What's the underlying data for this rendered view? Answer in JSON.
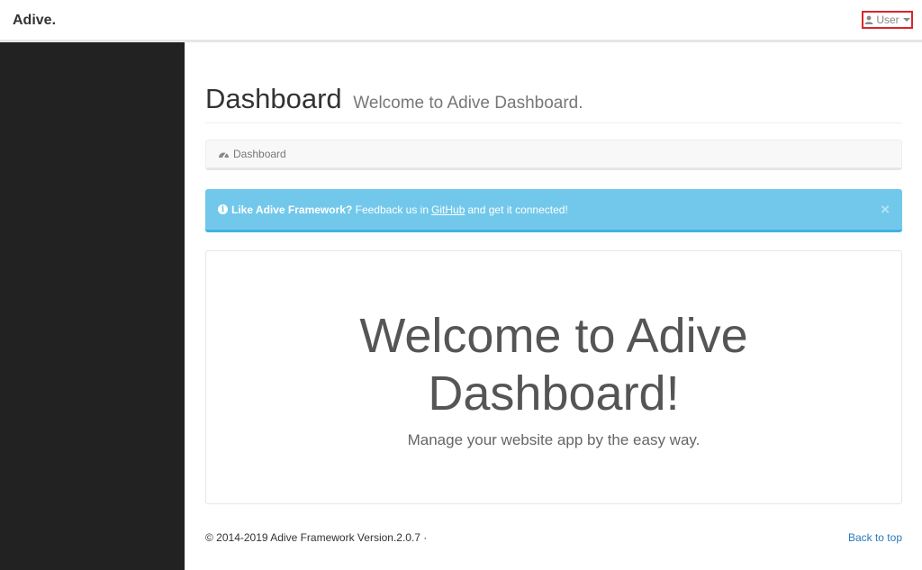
{
  "navbar": {
    "brand": "Adive.",
    "user_label": "User"
  },
  "header": {
    "title": "Dashboard",
    "subtitle": "Welcome to Adive Dashboard."
  },
  "breadcrumb": {
    "label": "Dashboard",
    "icon": "dashboard-icon"
  },
  "alert": {
    "strong": "Like Adive Framework?",
    "text_before": "Feedback us in",
    "link": "GitHub",
    "text_after": "and get it connected!",
    "close": "×",
    "color": "#72c8ea"
  },
  "hero": {
    "title_line1": "Welcome to Adive",
    "title_line2": "Dashboard!",
    "subtitle": "Manage your website app by the easy way."
  },
  "footer": {
    "copyright": "© 2014-2019 Adive Framework Version.2.0.7 ·",
    "back_to_top": "Back to top",
    "link_color": "#2a7bb8"
  },
  "colors": {
    "sidebar": "#222222",
    "user_menu_outline": "#d9262c"
  }
}
